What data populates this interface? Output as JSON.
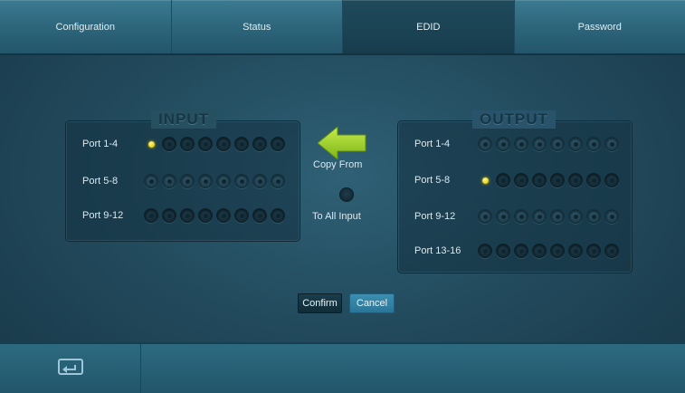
{
  "tabs": [
    {
      "label": "Configuration",
      "active": false
    },
    {
      "label": "Status",
      "active": false
    },
    {
      "label": "EDID",
      "active": true
    },
    {
      "label": "Password",
      "active": false
    }
  ],
  "input_panel": {
    "title": "INPUT",
    "rows": [
      {
        "label": "Port 1-4",
        "selected_index": 0
      },
      {
        "label": "Port 5-8",
        "selected_index": null
      },
      {
        "label": "Port 9-12",
        "selected_index": null
      }
    ]
  },
  "copy": {
    "copy_from_label": "Copy From",
    "to_all_input_label": "To All Input",
    "arrow_icon": "left-arrow-icon"
  },
  "output_panel": {
    "title": "OUTPUT",
    "rows": [
      {
        "label": "Port 1-4",
        "selected_index": null
      },
      {
        "label": "Port 5-8",
        "selected_index": 0
      },
      {
        "label": "Port 9-12",
        "selected_index": null
      },
      {
        "label": "Port 13-16",
        "selected_index": null
      }
    ]
  },
  "buttons": {
    "confirm": "Confirm",
    "cancel": "Cancel"
  },
  "footer": {
    "back_icon": "return-icon"
  },
  "colors": {
    "accent_button": "#2b7597",
    "selected_dot": "#e6d000",
    "arrow": "#8fcb1a"
  }
}
